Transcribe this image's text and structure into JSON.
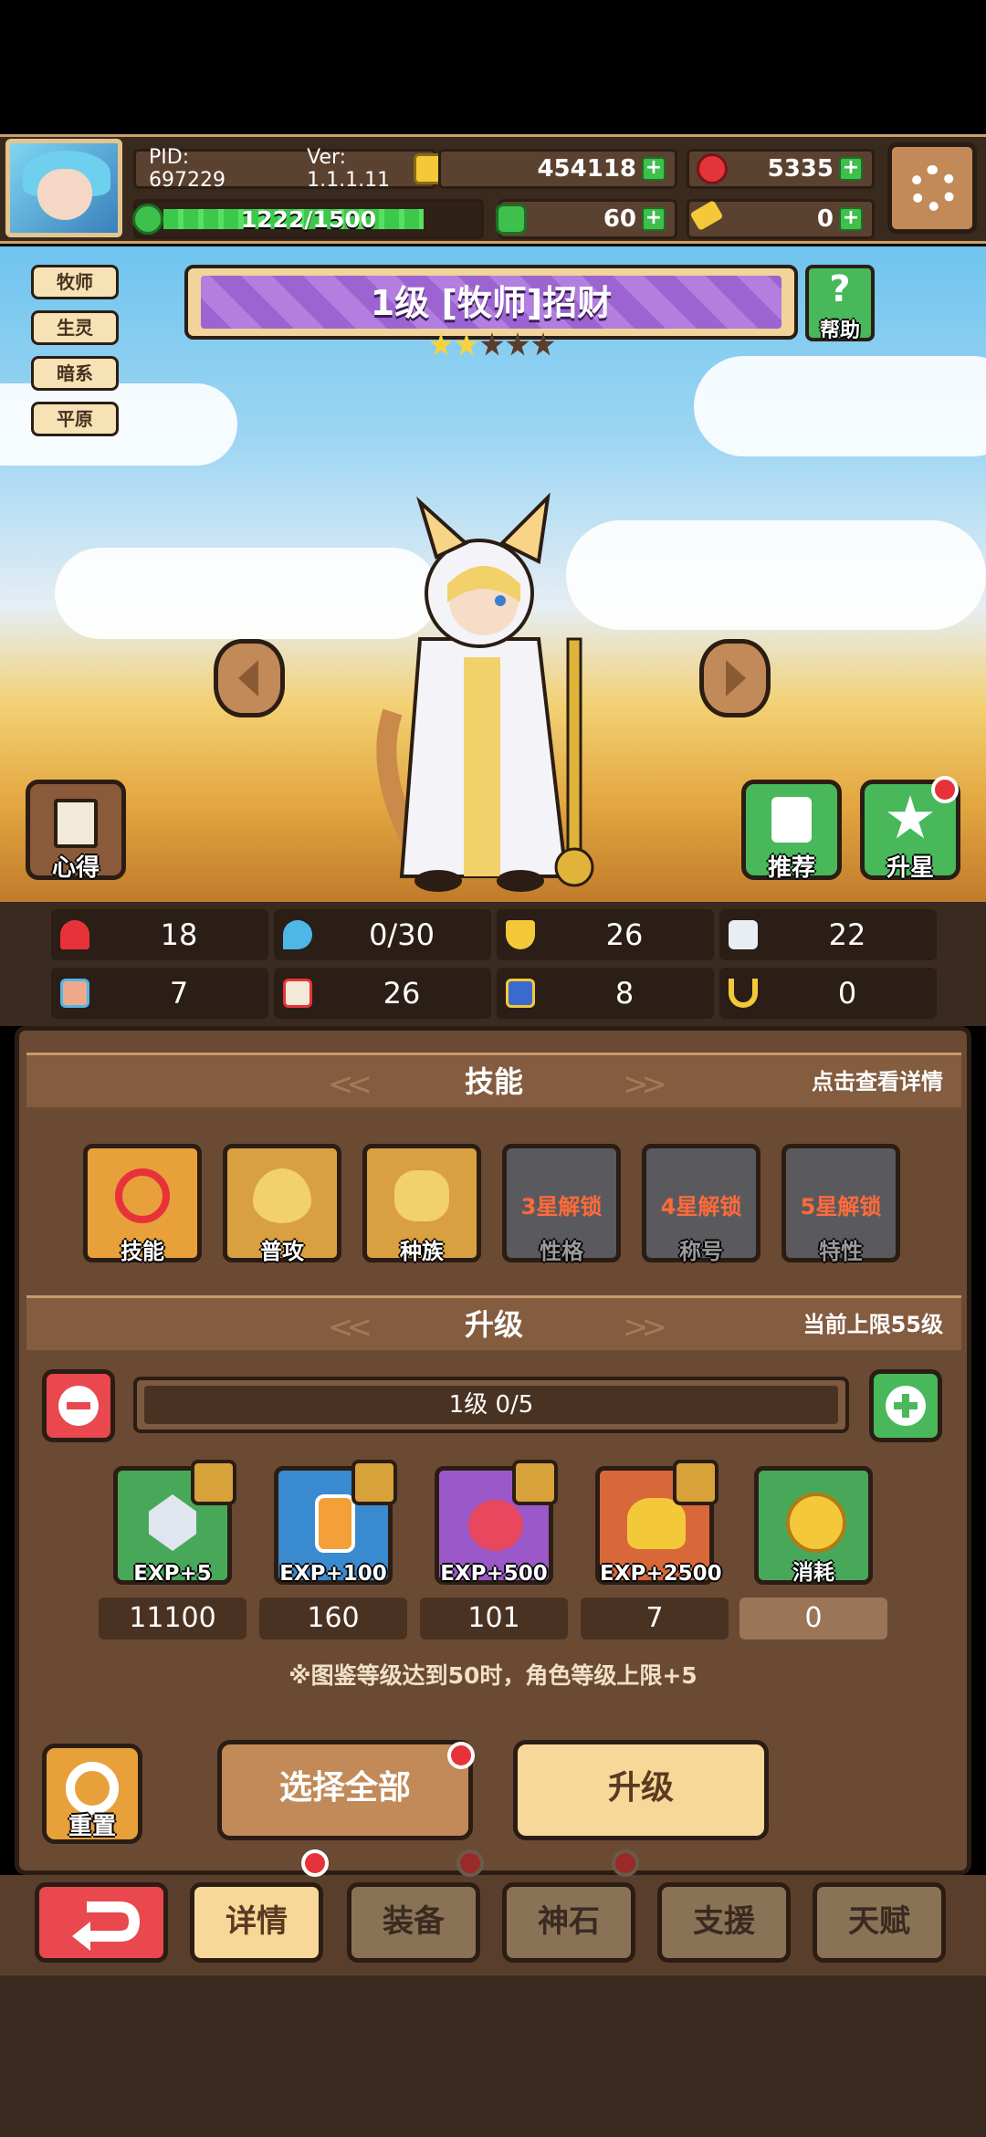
{
  "header": {
    "pid_label": "PID: 697229",
    "version_label": "Ver: 1.1.1.11",
    "coins": "454118",
    "gems": "5335",
    "hp": "1222/1500",
    "clovers": "60",
    "keys": "0"
  },
  "tags": [
    "牧师",
    "生灵",
    "暗系",
    "平原"
  ],
  "hero": {
    "title": "1级 [牧师]招财",
    "stars_on": 2,
    "stars_total": 5,
    "help_label": "帮助",
    "notes_label": "心得",
    "recommend_label": "推荐",
    "star_up_label": "升星"
  },
  "stats": [
    "18",
    "0/30",
    "26",
    "22",
    "7",
    "26",
    "8",
    "0"
  ],
  "skills": {
    "title": "技能",
    "hint": "点击查看详情",
    "items": [
      {
        "label": "技能",
        "lock": ""
      },
      {
        "label": "普攻",
        "lock": ""
      },
      {
        "label": "种族",
        "lock": ""
      },
      {
        "label": "性格",
        "lock": "3星解锁"
      },
      {
        "label": "称号",
        "lock": "4星解锁"
      },
      {
        "label": "特性",
        "lock": "5星解锁"
      }
    ]
  },
  "upgrade": {
    "title": "升级",
    "hint": "当前上限55级",
    "level_text": "1级  0/5",
    "items": [
      {
        "label": "EXP+5",
        "count": "11100"
      },
      {
        "label": "EXP+100",
        "count": "160"
      },
      {
        "label": "EXP+500",
        "count": "101"
      },
      {
        "label": "EXP+2500",
        "count": "7"
      },
      {
        "label": "消耗",
        "count": "0"
      }
    ],
    "note": "※图鉴等级达到50时，角色等级上限+5",
    "reset_label": "重置",
    "select_all_label": "选择全部",
    "upgrade_label": "升级"
  },
  "nav": {
    "details": "详情",
    "equipment": "装备",
    "godstone": "神石",
    "support": "支援",
    "talent": "天赋"
  }
}
